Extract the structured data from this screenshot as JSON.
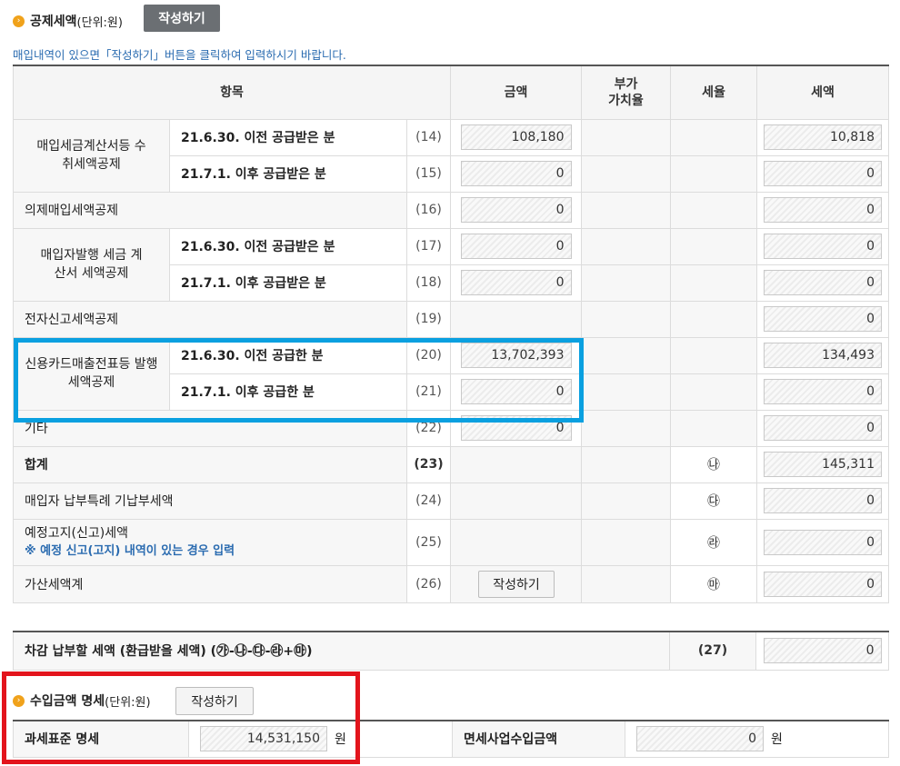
{
  "deduction_section": {
    "title": "공제세액",
    "unit": "(단위:원)",
    "write_button": "작성하기",
    "notice": "매입내역이 있으면「작성하기」버튼을 클릭하여 입력하시기 바랍니다."
  },
  "headers": {
    "item": "항목",
    "amount": "금액",
    "vat_rate_1": "부가",
    "vat_rate_2": "가치율",
    "tax_rate": "세율",
    "tax": "세액"
  },
  "rows": {
    "r14": {
      "group": "매입세금계산서등 수취세액공제",
      "sub": "21.6.30. 이전 공급받은 분",
      "no": "(14)",
      "amount": "108,180",
      "tax": "10,818"
    },
    "r15": {
      "sub": "21.7.1. 이후 공급받은 분",
      "no": "(15)",
      "amount": "0",
      "tax": "0"
    },
    "r16": {
      "label": "의제매입세액공제",
      "no": "(16)",
      "amount": "0",
      "tax": "0"
    },
    "r17": {
      "group": "매입자발행 세금 계산서 세액공제",
      "sub": "21.6.30. 이전 공급받은 분",
      "no": "(17)",
      "amount": "0",
      "tax": "0"
    },
    "r18": {
      "sub": "21.7.1. 이후 공급받은 분",
      "no": "(18)",
      "amount": "0",
      "tax": "0"
    },
    "r19": {
      "label": "전자신고세액공제",
      "no": "(19)",
      "tax": "0"
    },
    "r20": {
      "group": "신용카드매출전표등 발행세액공제",
      "sub": "21.6.30. 이전 공급한 분",
      "no": "(20)",
      "amount": "13,702,393",
      "tax": "134,493"
    },
    "r21": {
      "sub": "21.7.1. 이후 공급한 분",
      "no": "(21)",
      "amount": "0",
      "tax": "0"
    },
    "r22": {
      "label": "기타",
      "no": "(22)",
      "amount": "0",
      "tax": "0"
    },
    "r23": {
      "label": "합계",
      "no": "(23)",
      "mark": "㉯",
      "tax": "145,311"
    },
    "r24": {
      "label": "매입자 납부특례 기납부세액",
      "no": "(24)",
      "mark": "㉰",
      "tax": "0"
    },
    "r25": {
      "label": "예정고지(신고)세액",
      "note": "※ 예정 신고(고지) 내역이 있는 경우 입력",
      "no": "(25)",
      "mark": "㉱",
      "tax": "0"
    },
    "r26": {
      "label": "가산세액계",
      "no": "(26)",
      "button": "작성하기",
      "mark": "㉲",
      "tax": "0"
    }
  },
  "final_row": {
    "label": "차감 납부할 세액 (환급받을 세액) (㉮-㉯-㉰-㉱+㉲)",
    "no": "(27)",
    "value": "0"
  },
  "income_section": {
    "title": "수입금액 명세",
    "unit": "(단위:원)",
    "write_button": "작성하기",
    "taxable_label": "과세표준 명세",
    "taxable_value": "14,531,150",
    "taxable_unit": "원",
    "exempt_label": "면세사업수입금액",
    "exempt_value": "0",
    "exempt_unit": "원"
  },
  "highlight_colors": {
    "blue": "#0aa0e0",
    "red": "#e3141c",
    "accent": "#f0a21b"
  }
}
